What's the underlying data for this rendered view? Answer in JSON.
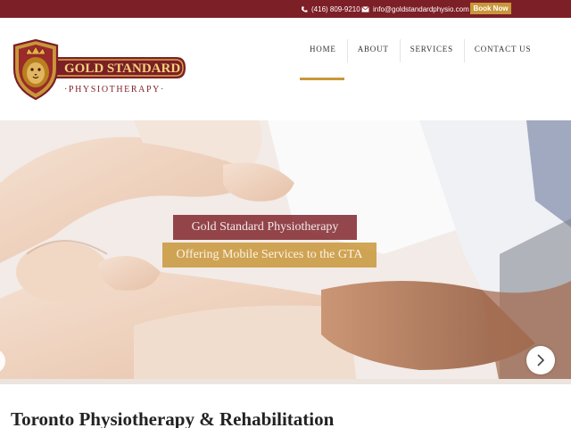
{
  "topbar": {
    "phone": "(416) 809-9210",
    "email": "info@goldstandardphysio.com",
    "book_label": "Book Now",
    "icons": [
      "phone-icon",
      "envelope-icon"
    ]
  },
  "logo": {
    "line1": "GOLD STANDARD",
    "line2": "·PHYSIOTHERAPY·"
  },
  "nav": {
    "items": [
      {
        "label": "HOME",
        "active": true
      },
      {
        "label": "ABOUT"
      },
      {
        "label": "SERVICES"
      },
      {
        "label": "CONTACT US"
      }
    ]
  },
  "slider": {
    "caption_line1": "Gold Standard Physiotherapy",
    "caption_line2": "Offering Mobile Services to the GTA",
    "next_icon": "chevron-right-icon"
  },
  "main": {
    "heading": "Toronto Physiotherapy & Rehabilitation"
  },
  "colors": {
    "brand_maroon": "#7d1f26",
    "accent_gold": "#c9973a"
  }
}
